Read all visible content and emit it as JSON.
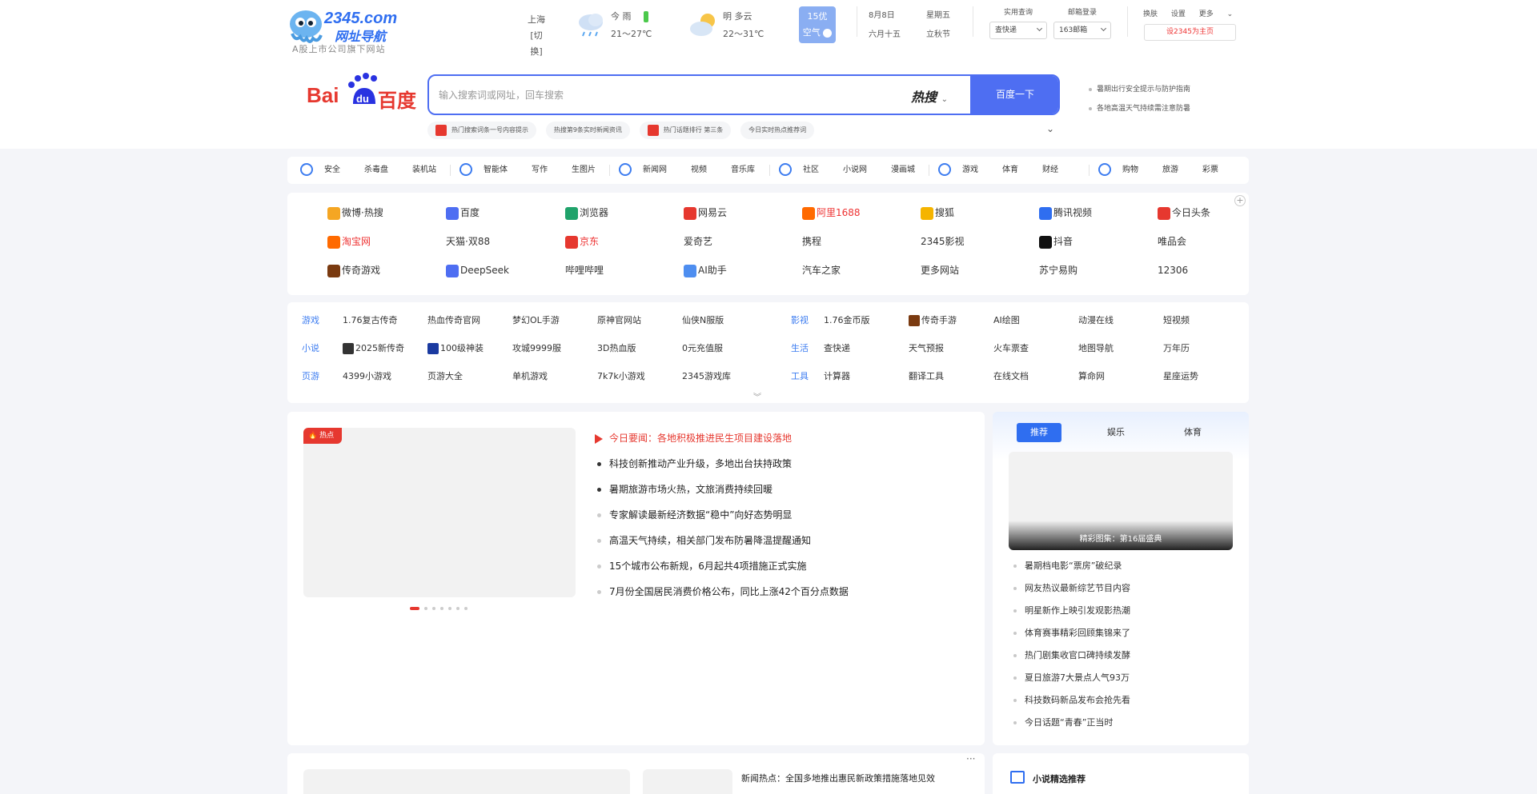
{
  "header": {
    "logo_text": "2345.com",
    "logo_cn": "网址导航",
    "logo_sub": "A股上市公司旗下网站",
    "city": [
      "上海",
      "[切换]"
    ],
    "weather": [
      {
        "label": "今 雨",
        "temp": "21～27℃"
      },
      {
        "label": "明 多云",
        "temp": "22～31℃"
      }
    ],
    "air": {
      "value": "15优",
      "label": "空气"
    },
    "calendar": {
      "date": "8月8日",
      "weekday": "星期五",
      "lunar": "六月十五",
      "term": "立秋节"
    },
    "selects": [
      {
        "label": "实用查询",
        "value": "查快递"
      },
      {
        "label": "邮箱登录",
        "value": "163邮箱"
      }
    ],
    "top_links": [
      "换肤",
      "设置",
      "更多"
    ],
    "home_button": "设2345为主页"
  },
  "search": {
    "engine": "百度",
    "placeholder": "输入搜索词或网址，回车搜索",
    "hot_label": "热搜",
    "button": "百度一下",
    "tags": [
      "热门搜索词条一号内容提示",
      "热搜第9条实时新闻资讯",
      "热门话题排行 第三条",
      "今日实时热点推荐词"
    ],
    "right_news": [
      "暑期出行安全提示与防护指南",
      "各地高温天气持续需注意防暑"
    ]
  },
  "categories": [
    {
      "icon": "shield-icon",
      "items": [
        "安全",
        "杀毒盘",
        "装机站"
      ]
    },
    {
      "icon": "robot-icon",
      "items": [
        "智能体",
        "写作",
        "生图片"
      ]
    },
    {
      "icon": "refresh-icon",
      "items": [
        "新闻网",
        "视频",
        "音乐库"
      ]
    },
    {
      "icon": "chat-icon",
      "items": [
        "社区",
        "小说网",
        "漫画城"
      ]
    },
    {
      "icon": "compass-icon",
      "items": [
        "游戏",
        "体育",
        "财经"
      ]
    },
    {
      "icon": "star-icon",
      "items": [
        "购物",
        "旅游",
        "彩票"
      ]
    }
  ],
  "sites": [
    [
      {
        "name": "微博·热搜",
        "icon": "#f5a623"
      },
      {
        "name": "百度",
        "icon": "#4e6ef2"
      },
      {
        "name": "浏览器",
        "icon": "#20a36b"
      },
      {
        "name": "网易云",
        "icon": "#e6382f"
      },
      {
        "name": "阿里1688",
        "icon": "#ff6a00",
        "red": true
      },
      {
        "name": "搜狐",
        "icon": "#f5b400"
      },
      {
        "name": "腾讯视频",
        "icon": "#2f6ef0"
      },
      {
        "name": "今日头条",
        "icon": "#e6382f"
      }
    ],
    [
      {
        "name": "淘宝网",
        "icon": "#ff6a00",
        "red": true
      },
      {
        "name": "天猫·双88",
        "icon": ""
      },
      {
        "name": "京东",
        "icon": "#e6382f",
        "red": true
      },
      {
        "name": "爱奇艺",
        "icon": ""
      },
      {
        "name": "携程",
        "icon": ""
      },
      {
        "name": "2345影视",
        "icon": ""
      },
      {
        "name": "抖音",
        "icon": "#111"
      },
      {
        "name": "唯品会",
        "icon": ""
      }
    ],
    [
      {
        "name": "传奇游戏",
        "icon": "#7a3a10"
      },
      {
        "name": "DeepSeek",
        "icon": "#4e6ef2"
      },
      {
        "name": "哔哩哔哩",
        "icon": ""
      },
      {
        "name": "AI助手",
        "icon": "#4e8ef0"
      },
      {
        "name": "汽车之家",
        "icon": ""
      },
      {
        "name": "更多网站",
        "icon": ""
      },
      {
        "name": "苏宁易购",
        "icon": ""
      },
      {
        "name": "12306",
        "icon": ""
      }
    ]
  ],
  "links2": [
    {
      "label": "游戏",
      "items": [
        {
          "t": "1.76复古传奇"
        },
        {
          "t": "热血传奇官网"
        },
        {
          "t": "梦幻OL手游"
        },
        {
          "t": "原神官网站"
        },
        {
          "t": "仙侠N服版"
        }
      ]
    },
    {
      "label": "影视",
      "items": [
        {
          "t": "1.76金币版",
          "icon": ""
        },
        {
          "t": "传奇手游",
          "icon": "#7a3a10"
        },
        {
          "t": "AI绘图"
        },
        {
          "t": "动漫在线"
        },
        {
          "t": "短视频"
        }
      ]
    },
    {
      "label": "小说",
      "items": [
        {
          "t": "2025新传奇",
          "icon": "#333"
        },
        {
          "t": "100级神装",
          "icon": "#1a3aa0"
        },
        {
          "t": "攻城9999服"
        },
        {
          "t": "3D热血版"
        },
        {
          "t": "0元充值服",
          "red": true
        }
      ]
    },
    {
      "label": "生活",
      "items": [
        {
          "t": "查快递"
        },
        {
          "t": "天气预报"
        },
        {
          "t": "火车票查"
        },
        {
          "t": "地图导航"
        },
        {
          "t": "万年历"
        }
      ]
    },
    {
      "label": "页游",
      "items": [
        {
          "t": "4399小游戏",
          "red": true
        },
        {
          "t": "页游大全"
        },
        {
          "t": "单机游戏"
        },
        {
          "t": "7k7k小游戏"
        },
        {
          "t": "2345游戏库"
        }
      ]
    },
    {
      "label": "工具",
      "items": [
        {
          "t": "计算器"
        },
        {
          "t": "翻译工具"
        },
        {
          "t": "在线文档"
        },
        {
          "t": "算命网"
        },
        {
          "t": "星座运势"
        }
      ]
    }
  ],
  "news": {
    "hot_badge": "热点",
    "items": [
      "今日要闻：各地积极推进民生项目建设落地",
      "科技创新推动产业升级，多地出台扶持政策",
      "暑期旅游市场火热，文旅消费持续回暖",
      "专家解读最新经济数据“稳中”向好态势明显",
      "高温天气持续，相关部门发布防暑降温提醒通知",
      "15个城市公布新规，6月起共4项措施正式实施",
      "7月份全国居民消费价格公布，同比上涨42个百分点数据"
    ]
  },
  "side": {
    "tabs": [
      "推荐",
      "娱乐",
      "体育"
    ],
    "image_caption": "精彩图集：第16届盛典",
    "items": [
      "暑期档电影“票房”破纪录",
      "网友热议最新综艺节目内容",
      "明星新作上映引发观影热潮",
      "体育赛事精彩回顾集锦来了",
      "热门剧集收官口碑持续发酵",
      "夏日旅游7大景点人气93万",
      "科技数码新品发布会抢先看",
      "今日话题“青春”正当时"
    ]
  },
  "bottom": {
    "news_title": "新闻热点：全国多地推出惠民新政策措施落地见效",
    "side_title": "小说精选推荐",
    "more": "···"
  }
}
